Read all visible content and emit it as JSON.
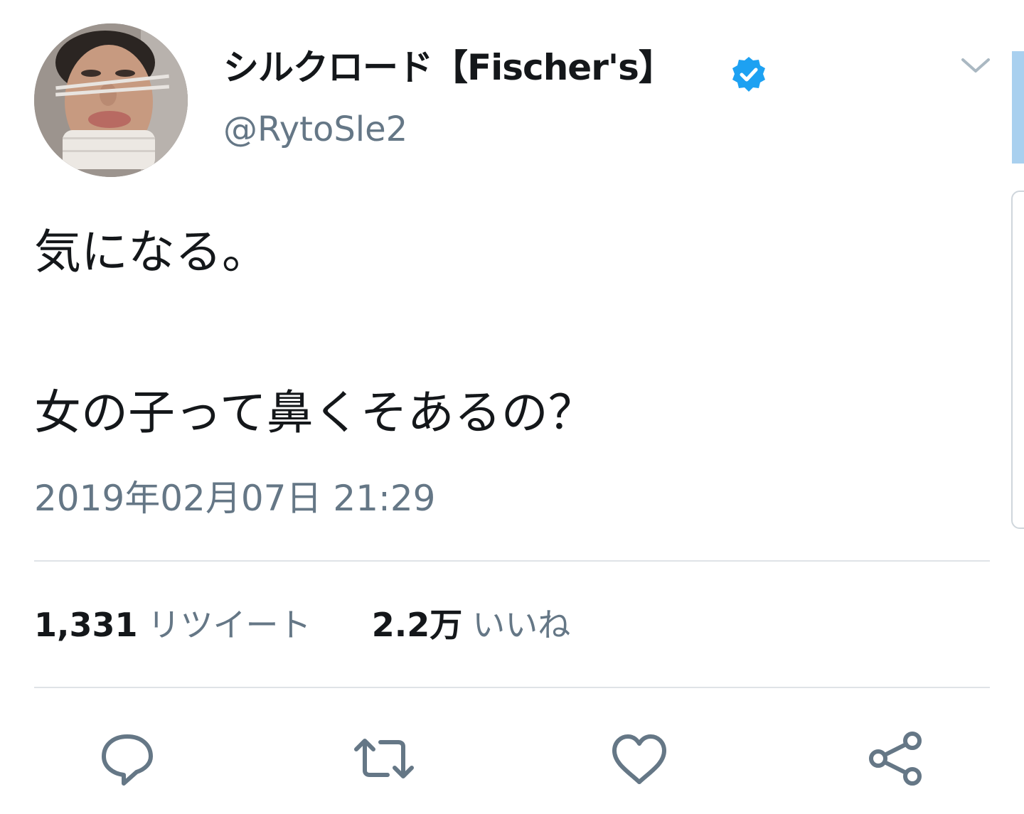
{
  "tweet": {
    "author": {
      "display_name": "シルクロード【Fischer's】",
      "handle": "@RytoSle2",
      "verified": true,
      "avatar_icon": "user-avatar"
    },
    "text_lines": [
      "気になる。",
      "女の子って鼻くそあるの？"
    ],
    "timestamp": "2019年02月07日 21:29",
    "stats": {
      "retweets_count": "1,331",
      "retweets_label": "リツイート",
      "likes_count": "2.2万",
      "likes_label": "いいね"
    },
    "actions": {
      "reply_icon": "reply-icon",
      "retweet_icon": "retweet-icon",
      "like_icon": "heart-icon",
      "share_icon": "share-icon"
    }
  },
  "colors": {
    "text": "#14171a",
    "secondary": "#657786",
    "verified_blue": "#1da1f2",
    "divider": "#dfe3e7",
    "accent": "#a9d0ef"
  }
}
